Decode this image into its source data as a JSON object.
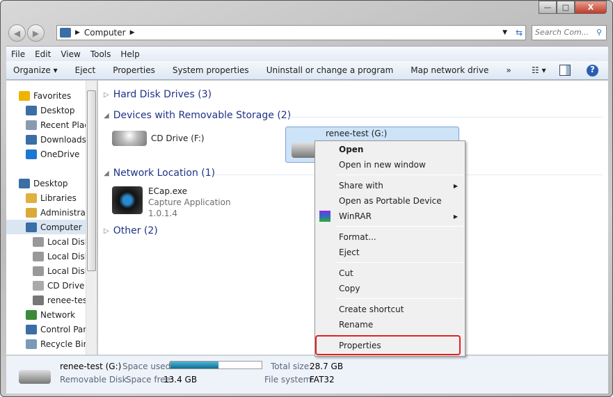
{
  "window": {
    "minimize": "—",
    "maximize": "□",
    "close": "X"
  },
  "address": {
    "path": [
      "Computer"
    ],
    "search_placeholder": "Search Com..."
  },
  "menu": [
    "File",
    "Edit",
    "View",
    "Tools",
    "Help"
  ],
  "toolbar": [
    "Organize ▾",
    "Eject",
    "Properties",
    "System properties",
    "Uninstall or change a program",
    "Map network drive",
    "»"
  ],
  "nav": [
    {
      "label": "Favorites",
      "icon": "star-icon",
      "color": "#f0b400"
    },
    {
      "label": "Desktop",
      "icon": "desktop-icon",
      "color": "#3a6ea5"
    },
    {
      "label": "Recent Places",
      "icon": "recent-places-icon",
      "color": "#8a9bb0"
    },
    {
      "label": "Downloads",
      "icon": "downloads-icon",
      "color": "#3a6ea5"
    },
    {
      "label": "OneDrive",
      "icon": "onedrive-icon",
      "color": "#1e78d0"
    },
    {
      "label": "Desktop",
      "icon": "desktop-icon",
      "color": "#3a6ea5"
    },
    {
      "label": "Libraries",
      "icon": "libraries-icon",
      "color": "#e0b040"
    },
    {
      "label": "Administrator",
      "icon": "user-folder-icon",
      "color": "#d9a93a"
    },
    {
      "label": "Computer",
      "icon": "computer-icon",
      "color": "#3a6ea5",
      "selected": true
    },
    {
      "label": "Local Disk (C:)",
      "icon": "disk-icon",
      "color": "#999"
    },
    {
      "label": "Local Disk (D:)",
      "icon": "disk-icon",
      "color": "#999"
    },
    {
      "label": "Local Disk (E:)",
      "icon": "disk-icon",
      "color": "#999"
    },
    {
      "label": "CD Drive (F:)",
      "icon": "cd-drive-icon",
      "color": "#aaa"
    },
    {
      "label": "renee-test (G:)",
      "icon": "usb-drive-icon",
      "color": "#777"
    },
    {
      "label": "Network",
      "icon": "network-icon",
      "color": "#3a8a3a"
    },
    {
      "label": "Control Panel",
      "icon": "control-panel-icon",
      "color": "#3a6ea5"
    },
    {
      "label": "Recycle Bin",
      "icon": "recycle-bin-icon",
      "color": "#7a9ab8"
    }
  ],
  "groups": {
    "hdd": "Hard Disk Drives (3)",
    "removable": "Devices with Removable Storage (2)",
    "network": "Network Location (1)",
    "other": "Other (2)"
  },
  "items": {
    "cd": "CD Drive (F:)",
    "usb": "renee-test (G:)",
    "ecap": {
      "name": "ECap.exe",
      "desc": "Capture Application",
      "version": "1.0.1.4"
    }
  },
  "context_menu": [
    "Open",
    "Open in new window",
    "Share with",
    "Open as Portable Device",
    "WinRAR",
    "Format...",
    "Eject",
    "Cut",
    "Copy",
    "Create shortcut",
    "Rename",
    "Properties"
  ],
  "status": {
    "name": "renee-test (G:)",
    "type": "Removable Disk",
    "used_label": "Space used:",
    "used_fraction": 0.53,
    "free_label": "Space free:",
    "free": "13.4 GB",
    "total_label": "Total size:",
    "total": "28.7 GB",
    "fs_label": "File system:",
    "fs": "FAT32"
  }
}
